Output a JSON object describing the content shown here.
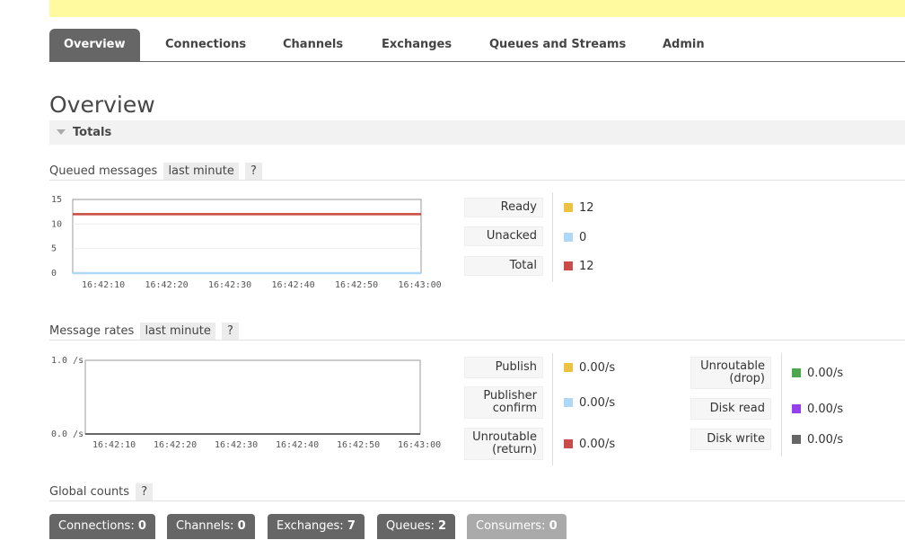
{
  "tabs": [
    {
      "label": "Overview",
      "active": true
    },
    {
      "label": "Connections"
    },
    {
      "label": "Channels"
    },
    {
      "label": "Exchanges"
    },
    {
      "label": "Queues and Streams"
    },
    {
      "label": "Admin"
    }
  ],
  "page_title": "Overview",
  "totals": {
    "label": "Totals"
  },
  "queued": {
    "title": "Queued messages",
    "range": "last minute",
    "help": "?",
    "chart": {
      "y_ticks": [
        "15",
        "10",
        "5",
        "0"
      ],
      "x_ticks": [
        "16:42:10",
        "16:42:20",
        "16:42:30",
        "16:42:40",
        "16:42:50",
        "16:43:00"
      ],
      "ylim": [
        0,
        15
      ],
      "series": [
        {
          "key": "ready",
          "color": "#edc240",
          "values": [
            12,
            12,
            12,
            12,
            12,
            12,
            12
          ]
        },
        {
          "key": "unacked",
          "color": "#afd8f8",
          "values": [
            0,
            0,
            0,
            0,
            0,
            0,
            0
          ]
        },
        {
          "key": "total",
          "color": "#cb4b4b",
          "values": [
            12,
            12,
            12,
            12,
            12,
            12,
            12
          ]
        }
      ]
    },
    "legend": [
      {
        "label": "Ready",
        "value": "12",
        "color": "#edc240"
      },
      {
        "label": "Unacked",
        "value": "0",
        "color": "#afd8f8"
      },
      {
        "label": "Total",
        "value": "12",
        "color": "#cb4b4b"
      }
    ]
  },
  "rates": {
    "title": "Message rates",
    "range": "last minute",
    "help": "?",
    "chart": {
      "y_ticks": [
        "1.0 /s",
        "0.0 /s"
      ],
      "x_ticks": [
        "16:42:10",
        "16:42:20",
        "16:42:30",
        "16:42:40",
        "16:42:50",
        "16:43:00"
      ]
    },
    "legend_left": [
      {
        "label_lines": [
          "Publish"
        ],
        "value": "0.00/s",
        "color": "#edc240"
      },
      {
        "label_lines": [
          "Publisher",
          "confirm"
        ],
        "value": "0.00/s",
        "color": "#afd8f8"
      },
      {
        "label_lines": [
          "Unroutable",
          "(return)"
        ],
        "value": "0.00/s",
        "color": "#cb4b4b"
      }
    ],
    "legend_right": [
      {
        "label_lines": [
          "Unroutable",
          "(drop)"
        ],
        "value": "0.00/s",
        "color": "#4da74d"
      },
      {
        "label_lines": [
          "Disk read"
        ],
        "value": "0.00/s",
        "color": "#9440ed"
      },
      {
        "label_lines": [
          "Disk write"
        ],
        "value": "0.00/s",
        "color": "#666666"
      }
    ]
  },
  "global": {
    "title": "Global counts",
    "help": "?",
    "counts": [
      {
        "label": "Connections:",
        "value": "0"
      },
      {
        "label": "Channels:",
        "value": "0"
      },
      {
        "label": "Exchanges:",
        "value": "7"
      },
      {
        "label": "Queues:",
        "value": "2"
      },
      {
        "label": "Consumers:",
        "value": "0",
        "dim": true
      }
    ]
  }
}
